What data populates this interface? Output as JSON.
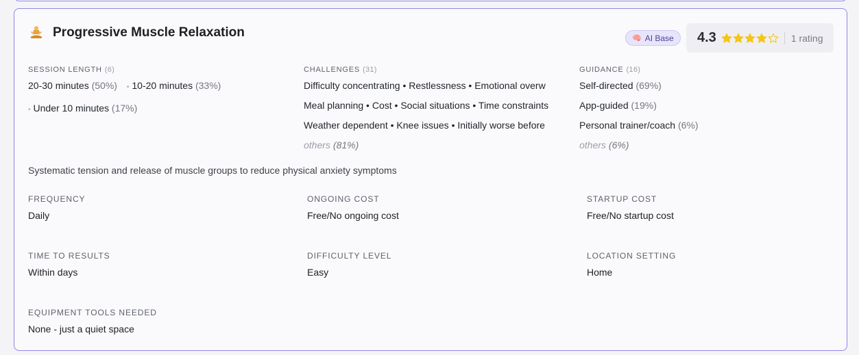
{
  "card": {
    "title": "Progressive Muscle Relaxation",
    "emoji_icon": "person-meditating-icon",
    "ai_badge": {
      "icon": "brain-icon",
      "label": "AI Base"
    },
    "rating": {
      "value": "4.3",
      "stars_filled": 4,
      "stars_total": 5,
      "count_label": "1 rating",
      "star_color": "#f5c518"
    },
    "session_length": {
      "label": "SESSION LENGTH",
      "count": "(6)",
      "items": [
        {
          "text": "20-30 minutes",
          "pct": "(50%)"
        },
        {
          "text": "10-20 minutes",
          "pct": "(33%)"
        },
        {
          "text": "Under 10 minutes",
          "pct": "(17%)"
        }
      ]
    },
    "challenges": {
      "label": "CHALLENGES",
      "count": "(31)",
      "lines": [
        "Difficulty concentrating • Restlessness • Emotional overw",
        "Meal planning • Cost • Social situations • Time constraints",
        "Weather dependent • Knee issues • Initially worse before"
      ],
      "others_label": "others",
      "others_pct": "(81%)"
    },
    "guidance": {
      "label": "GUIDANCE",
      "count": "(16)",
      "items": [
        {
          "text": "Self-directed",
          "pct": "(69%)"
        },
        {
          "text": "App-guided",
          "pct": "(19%)"
        },
        {
          "text": "Personal trainer/coach",
          "pct": "(6%)"
        }
      ],
      "others_label": "others",
      "others_pct": "(6%)"
    },
    "description": "Systematic tension and release of muscle groups to reduce physical anxiety symptoms",
    "attributes": {
      "frequency": {
        "label": "FREQUENCY",
        "value": "Daily"
      },
      "ongoing_cost": {
        "label": "ONGOING COST",
        "value": "Free/No ongoing cost"
      },
      "startup_cost": {
        "label": "STARTUP COST",
        "value": "Free/No startup cost"
      },
      "time_to_results": {
        "label": "TIME TO RESULTS",
        "value": "Within days"
      },
      "difficulty_level": {
        "label": "DIFFICULTY LEVEL",
        "value": "Easy"
      },
      "location_setting": {
        "label": "LOCATION SETTING",
        "value": "Home"
      },
      "equipment": {
        "label": "EQUIPMENT TOOLS NEEDED",
        "value": "None - just a quiet space"
      }
    }
  }
}
